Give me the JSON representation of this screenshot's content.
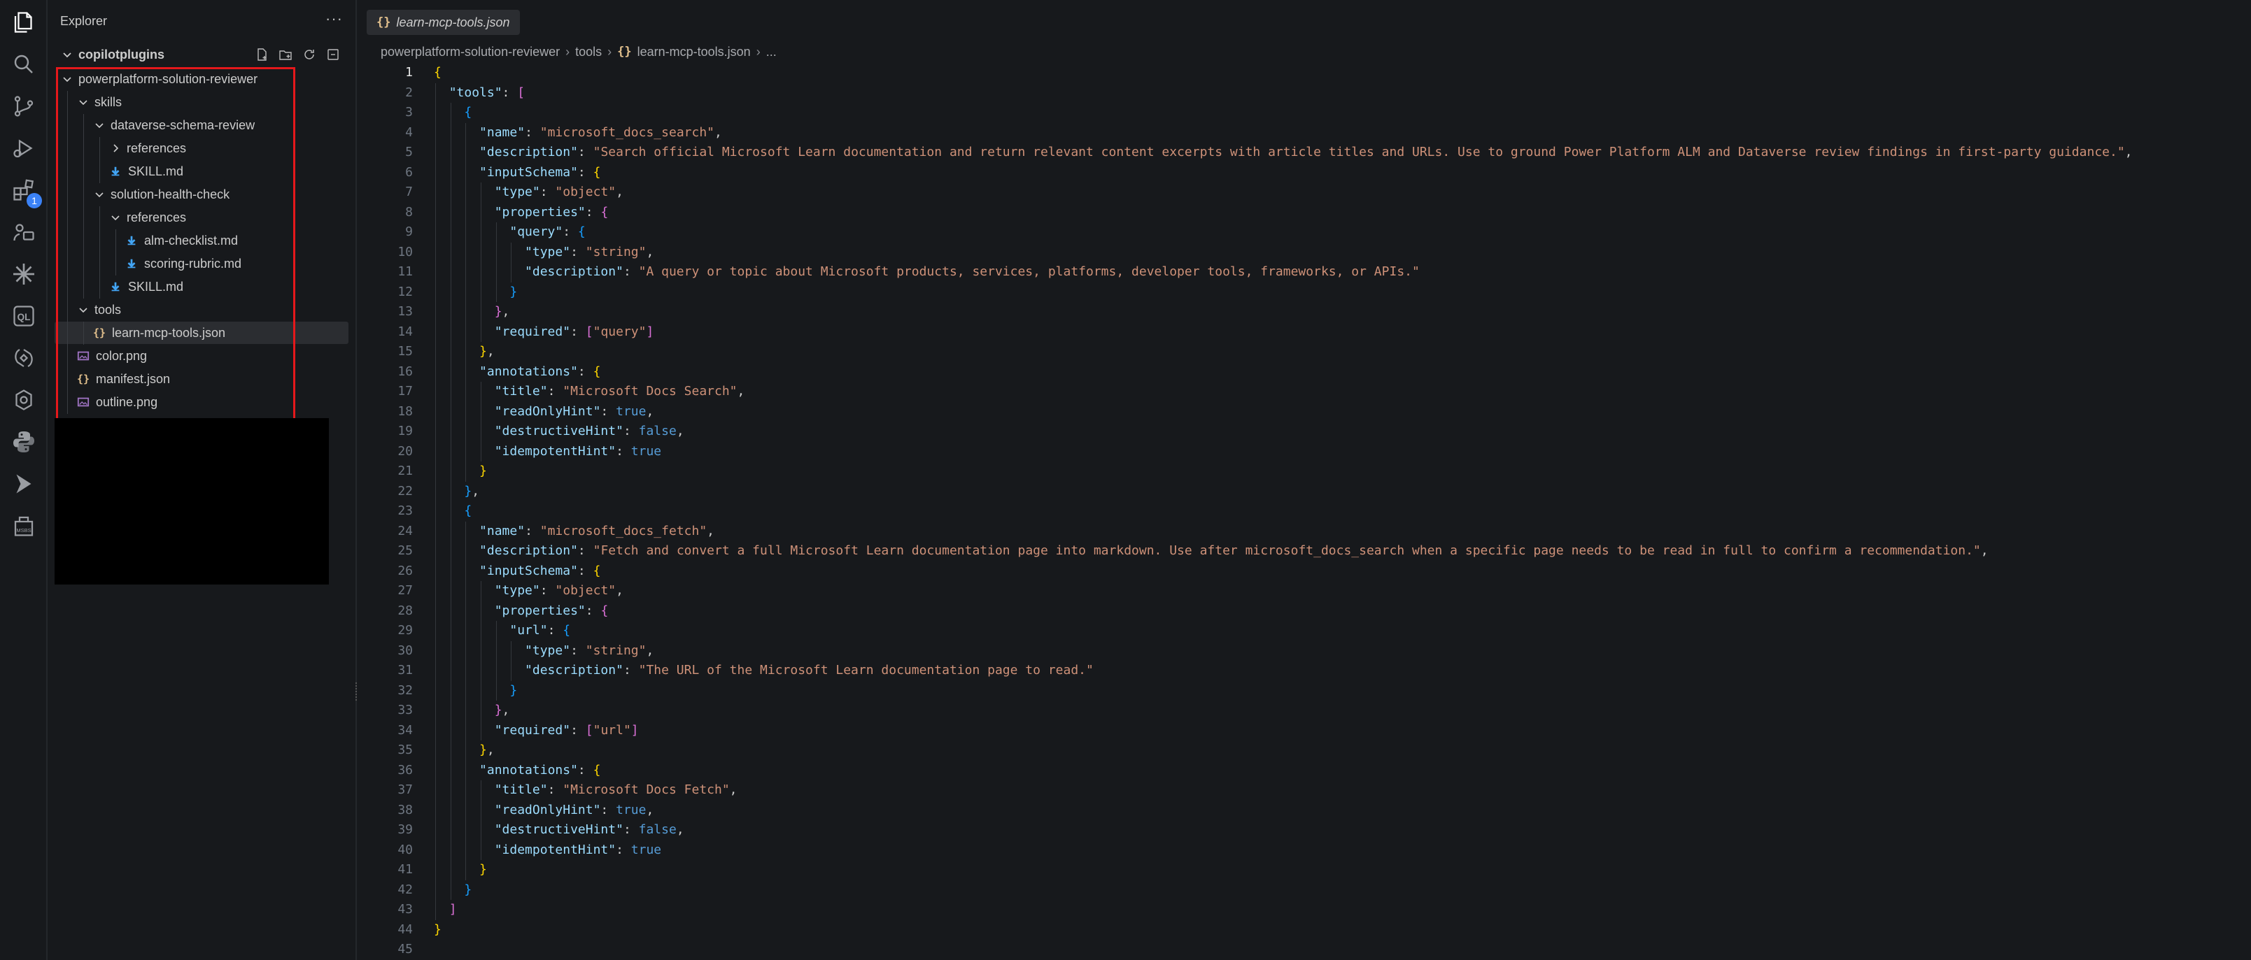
{
  "activity_bar": {
    "items": [
      "explorer-icon",
      "search-icon",
      "source-control-icon",
      "run-debug-icon",
      "extensions-icon",
      "remote-icon",
      "spark-icon",
      "ql-icon",
      "copilot-icon",
      "gear-loop-icon",
      "python-icon",
      "terminal-arrow-icon",
      "msbuild-icon"
    ],
    "extensions_badge": "1",
    "ql_label": "QL",
    "msbuild_label": "MSBS"
  },
  "sidebar": {
    "title": "Explorer",
    "more": "···",
    "section": "copilotplugins",
    "tree": [
      {
        "label": "powerplatform-solution-reviewer",
        "depth": 0,
        "kind": "folder-open"
      },
      {
        "label": "skills",
        "depth": 1,
        "kind": "folder-open"
      },
      {
        "label": "dataverse-schema-review",
        "depth": 2,
        "kind": "folder-open"
      },
      {
        "label": "references",
        "depth": 3,
        "kind": "folder-closed"
      },
      {
        "label": "SKILL.md",
        "depth": 3,
        "kind": "md"
      },
      {
        "label": "solution-health-check",
        "depth": 2,
        "kind": "folder-open"
      },
      {
        "label": "references",
        "depth": 3,
        "kind": "folder-open"
      },
      {
        "label": "alm-checklist.md",
        "depth": 4,
        "kind": "md"
      },
      {
        "label": "scoring-rubric.md",
        "depth": 4,
        "kind": "md"
      },
      {
        "label": "SKILL.md",
        "depth": 3,
        "kind": "md"
      },
      {
        "label": "tools",
        "depth": 1,
        "kind": "folder-open"
      },
      {
        "label": "learn-mcp-tools.json",
        "depth": 2,
        "kind": "json",
        "selected": true
      },
      {
        "label": "color.png",
        "depth": 1,
        "kind": "png"
      },
      {
        "label": "manifest.json",
        "depth": 1,
        "kind": "json"
      },
      {
        "label": "outline.png",
        "depth": 1,
        "kind": "png"
      }
    ]
  },
  "editor": {
    "tab": {
      "icon": "{}",
      "label": "learn-mcp-tools.json"
    },
    "breadcrumb": [
      "powerplatform-solution-reviewer",
      "tools",
      "learn-mcp-tools.json",
      "..."
    ],
    "current_line": 1,
    "lines": [
      "{",
      "  \"tools\": [",
      "    {",
      "      \"name\": \"microsoft_docs_search\",",
      "      \"description\": \"Search official Microsoft Learn documentation and return relevant content excerpts with article titles and URLs. Use to ground Power Platform ALM and Dataverse review findings in first-party guidance.\",",
      "      \"inputSchema\": {",
      "        \"type\": \"object\",",
      "        \"properties\": {",
      "          \"query\": {",
      "            \"type\": \"string\",",
      "            \"description\": \"A query or topic about Microsoft products, services, platforms, developer tools, frameworks, or APIs.\"",
      "          }",
      "        },",
      "        \"required\": [\"query\"]",
      "      },",
      "      \"annotations\": {",
      "        \"title\": \"Microsoft Docs Search\",",
      "        \"readOnlyHint\": true,",
      "        \"destructiveHint\": false,",
      "        \"idempotentHint\": true",
      "      }",
      "    },",
      "    {",
      "      \"name\": \"microsoft_docs_fetch\",",
      "      \"description\": \"Fetch and convert a full Microsoft Learn documentation page into markdown. Use after microsoft_docs_search when a specific page needs to be read in full to confirm a recommendation.\",",
      "      \"inputSchema\": {",
      "        \"type\": \"object\",",
      "        \"properties\": {",
      "          \"url\": {",
      "            \"type\": \"string\",",
      "            \"description\": \"The URL of the Microsoft Learn documentation page to read.\"",
      "          }",
      "        },",
      "        \"required\": [\"url\"]",
      "      },",
      "      \"annotations\": {",
      "        \"title\": \"Microsoft Docs Fetch\",",
      "        \"readOnlyHint\": true,",
      "        \"destructiveHint\": false,",
      "        \"idempotentHint\": true",
      "      }",
      "    }",
      "  ]",
      "}",
      ""
    ]
  },
  "colors": {
    "background": "#17191c",
    "selection": "#2b2d31",
    "highlight_box": "#e5181b",
    "json_icon": "#e2c08d",
    "md_icon": "#42a5f5",
    "png_icon": "#a074c4",
    "key": "#9cdcfe",
    "string": "#ce9178",
    "boolean": "#569cd6"
  }
}
